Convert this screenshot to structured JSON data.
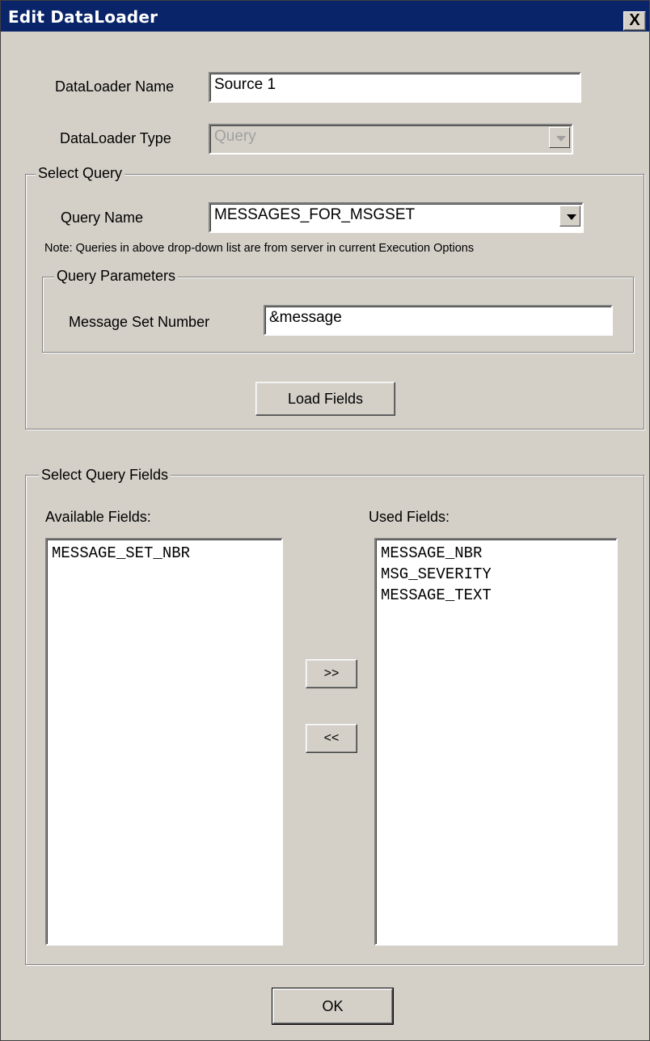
{
  "window": {
    "title": "Edit DataLoader",
    "close_label": "X"
  },
  "dataloader_name": {
    "label": "DataLoader Name",
    "value": "Source 1"
  },
  "dataloader_type": {
    "label": "DataLoader Type",
    "value": "Query"
  },
  "select_query": {
    "title": "Select Query",
    "query_name_label": "Query Name",
    "query_name_value": "MESSAGES_FOR_MSGSET",
    "note": "Note: Queries in above drop-down list are from server in current Execution Options",
    "parameters": {
      "title": "Query Parameters",
      "message_set_label": "Message Set Number",
      "message_set_value": "&message"
    },
    "load_fields_label": "Load Fields"
  },
  "select_fields": {
    "title": "Select Query Fields",
    "available_label": "Available Fields:",
    "used_label": "Used Fields:",
    "available": [
      "MESSAGE_SET_NBR"
    ],
    "used": [
      "MESSAGE_NBR",
      "MSG_SEVERITY",
      "MESSAGE_TEXT"
    ],
    "add_label": ">>",
    "remove_label": "<<"
  },
  "ok_label": "OK"
}
